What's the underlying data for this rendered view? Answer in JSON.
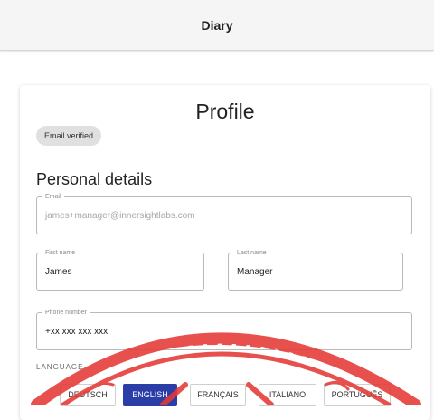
{
  "appbar": {
    "title": "Diary"
  },
  "card": {
    "title": "Profile",
    "verified_chip": "Email verified",
    "section_title": "Personal details",
    "fields": {
      "email": {
        "label": "Email",
        "value": "james+manager@innersightlabs.com"
      },
      "first_name": {
        "label": "First name",
        "value": "James"
      },
      "last_name": {
        "label": "Last name",
        "value": "Manager"
      },
      "phone": {
        "label": "Phone number",
        "value": "+xx xxx xxx xxx"
      }
    },
    "language": {
      "label": "LANGUAGE",
      "options": [
        "DEUTSCH",
        "ENGLISH",
        "FRANÇAIS",
        "ITALIANO",
        "PORTUGUÊS"
      ],
      "selected": "ENGLISH"
    }
  },
  "colors": {
    "accent": "#2b3ea8",
    "stamp": "#e53935"
  }
}
